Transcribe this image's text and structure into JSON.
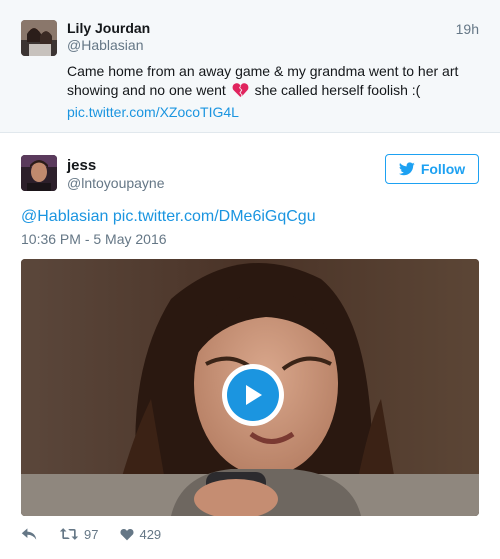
{
  "parent_tweet": {
    "display_name": "Lily Jourdan",
    "handle": "@Hablasian",
    "time_ago": "19h",
    "text_before": "Came home from an away game & my grandma went to her art showing and no one went",
    "text_after": "she called herself foolish :(",
    "link": "pic.twitter.com/XZocoTIG4L",
    "emoji_icon": "broken-heart-icon"
  },
  "main_tweet": {
    "display_name": "jess",
    "handle": "@lntoyoupayne",
    "follow_label": "Follow",
    "mention": "@Hablasian",
    "link": "pic.twitter.com/DMe6iGqCgu",
    "timestamp": "10:36 PM - 5 May 2016",
    "retweet_count": "97",
    "like_count": "429"
  },
  "colors": {
    "accent": "#1da1f2",
    "link": "#1b95e0",
    "muted": "#657786",
    "parent_bg": "#f5f8fa",
    "broken_heart": "#e0245e"
  }
}
